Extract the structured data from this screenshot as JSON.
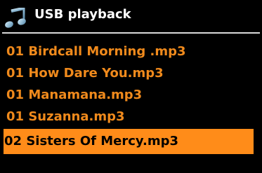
{
  "colors": {
    "background": "#000000",
    "text": "#f08a1c",
    "title_text": "#ffffff",
    "divider": "#d9d9d9",
    "selected_background": "#ff8c19",
    "selected_text": "#000000"
  },
  "header": {
    "icon": "music-note-icon",
    "title": "USB playback"
  },
  "tracks": [
    {
      "label": "01 Birdcall Morning .mp3",
      "selected": false
    },
    {
      "label": "01 How Dare You.mp3",
      "selected": false
    },
    {
      "label": "01 Manamana.mp3",
      "selected": false
    },
    {
      "label": "01 Suzanna.mp3",
      "selected": false
    },
    {
      "label": "02 Sisters Of Mercy.mp3",
      "selected": true
    }
  ]
}
